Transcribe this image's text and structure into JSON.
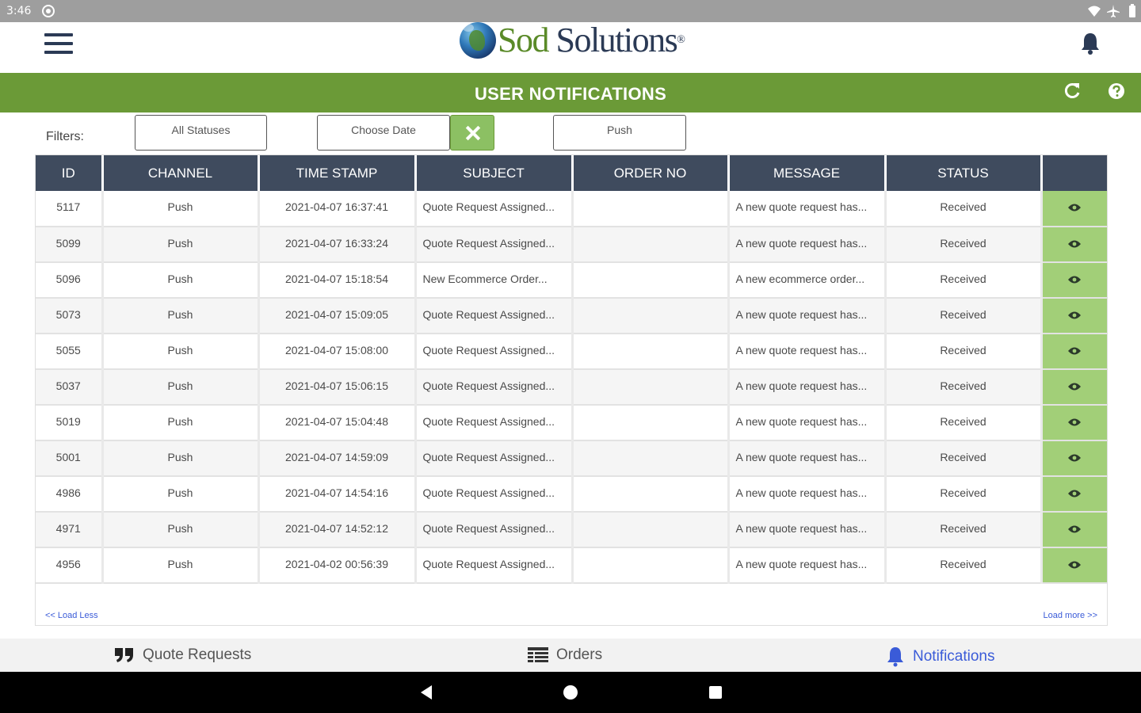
{
  "statusbar": {
    "time": "3:46"
  },
  "appbar": {
    "logo_word1": "Sod",
    "logo_word2": " Solutions",
    "logo_mark": "®"
  },
  "page": {
    "title": "USER NOTIFICATIONS"
  },
  "filters": {
    "label": "Filters:",
    "status": "All Statuses",
    "date": "Choose Date",
    "channel": "Push"
  },
  "table": {
    "columns": [
      "ID",
      "CHANNEL",
      "TIME STAMP",
      "SUBJECT",
      "ORDER NO",
      "MESSAGE",
      "STATUS",
      ""
    ],
    "rows": [
      {
        "id": "5117",
        "channel": "Push",
        "timestamp": "2021-04-07 16:37:41",
        "subject": "Quote Request Assigned...",
        "order_no": "",
        "message": "A new quote request has...",
        "status": "Received"
      },
      {
        "id": "5099",
        "channel": "Push",
        "timestamp": "2021-04-07 16:33:24",
        "subject": "Quote Request Assigned...",
        "order_no": "",
        "message": "A new quote request has...",
        "status": "Received"
      },
      {
        "id": "5096",
        "channel": "Push",
        "timestamp": "2021-04-07 15:18:54",
        "subject": "New Ecommerce Order...",
        "order_no": "",
        "message": "A new ecommerce order...",
        "status": "Received"
      },
      {
        "id": "5073",
        "channel": "Push",
        "timestamp": "2021-04-07 15:09:05",
        "subject": "Quote Request Assigned...",
        "order_no": "",
        "message": "A new quote request has...",
        "status": "Received"
      },
      {
        "id": "5055",
        "channel": "Push",
        "timestamp": "2021-04-07 15:08:00",
        "subject": "Quote Request Assigned...",
        "order_no": "",
        "message": "A new quote request has...",
        "status": "Received"
      },
      {
        "id": "5037",
        "channel": "Push",
        "timestamp": "2021-04-07 15:06:15",
        "subject": "Quote Request Assigned...",
        "order_no": "",
        "message": "A new quote request has...",
        "status": "Received"
      },
      {
        "id": "5019",
        "channel": "Push",
        "timestamp": "2021-04-07 15:04:48",
        "subject": "Quote Request Assigned...",
        "order_no": "",
        "message": "A new quote request has...",
        "status": "Received"
      },
      {
        "id": "5001",
        "channel": "Push",
        "timestamp": "2021-04-07 14:59:09",
        "subject": "Quote Request Assigned...",
        "order_no": "",
        "message": "A new quote request has...",
        "status": "Received"
      },
      {
        "id": "4986",
        "channel": "Push",
        "timestamp": "2021-04-07 14:54:16",
        "subject": "Quote Request Assigned...",
        "order_no": "",
        "message": "A new quote request has...",
        "status": "Received"
      },
      {
        "id": "4971",
        "channel": "Push",
        "timestamp": "2021-04-07 14:52:12",
        "subject": "Quote Request Assigned...",
        "order_no": "",
        "message": "A new quote request has...",
        "status": "Received"
      },
      {
        "id": "4956",
        "channel": "Push",
        "timestamp": "2021-04-02 00:56:39",
        "subject": "Quote Request Assigned...",
        "order_no": "",
        "message": "A new quote request has...",
        "status": "Received"
      }
    ],
    "load_less": "<< Load Less",
    "load_more": "Load more >>"
  },
  "bottomnav": {
    "items": [
      {
        "label": "Quote Requests",
        "icon": "quote-icon",
        "active": false
      },
      {
        "label": "Orders",
        "icon": "list-icon",
        "active": false
      },
      {
        "label": "Notifications",
        "icon": "bell-icon",
        "active": true
      }
    ]
  },
  "colors": {
    "header_green": "#6b9a37",
    "view_cell_green": "#a2cf78",
    "table_header": "#3f4b5e",
    "active_nav": "#3a5bd8"
  }
}
